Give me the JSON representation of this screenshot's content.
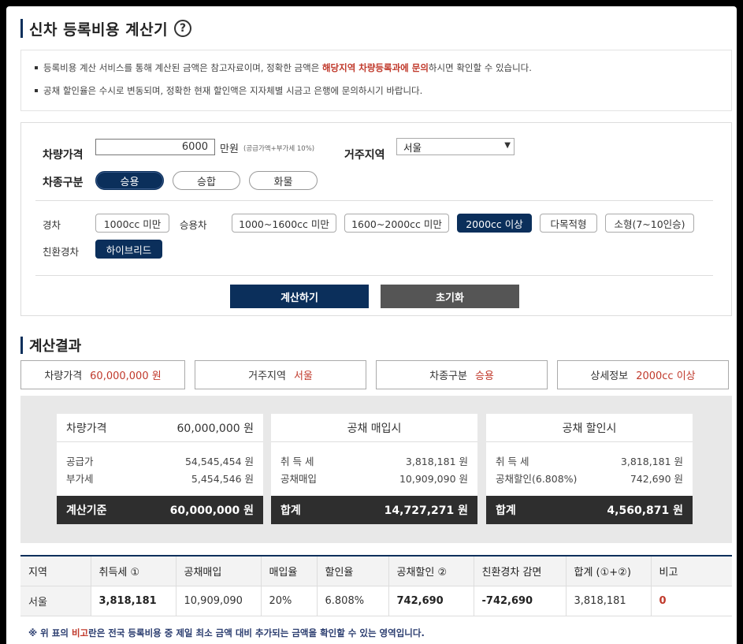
{
  "header": {
    "title": "신차 등록비용 계산기",
    "help_icon": "?"
  },
  "notice": {
    "line1_pre": "등록비용 계산 서비스를 통해 계산된 금액은 참고자료이며, 정확한 금액은 ",
    "line1_em": "해당지역 차량등록과에 문의",
    "line1_post": "하시면 확인할 수 있습니다.",
    "line2": "공채 할인율은 수시로 변동되며, 정확한 현재 할인액은 지자체별 시금고 은행에 문의하시기 바랍니다."
  },
  "form": {
    "price_label": "차량가격",
    "price_value": "6000",
    "price_unit": "만원",
    "price_note": "(공급가액+부가세 10%)",
    "region_label": "거주지역",
    "region_value": "서울",
    "type_label": "차종구분",
    "types": [
      "승용",
      "승합",
      "화물"
    ],
    "type_selected": "승용",
    "light_label": "경차",
    "light_options": [
      "1000cc 미만"
    ],
    "passenger_label": "승용차",
    "passenger_options": [
      "1000~1600cc 미만",
      "1600~2000cc 미만",
      "2000cc 이상",
      "다목적형",
      "소형(7~10인승)"
    ],
    "passenger_selected": "2000cc 이상",
    "eco_label": "친환경차",
    "eco_options": [
      "하이브리드"
    ],
    "calc_button": "계산하기",
    "reset_button": "초기화"
  },
  "result": {
    "title": "계산결과",
    "summary": [
      {
        "label": "차량가격",
        "value": "60,000,000 원"
      },
      {
        "label": "거주지역",
        "value": "서울"
      },
      {
        "label": "차종구분",
        "value": "승용"
      },
      {
        "label": "상세정보",
        "value": "2000cc 이상"
      }
    ],
    "card_price": {
      "head_label": "차량가격",
      "head_value": "60,000,000 원",
      "row1_label": "공급가",
      "row1_value": "54,545,454 원",
      "row2_label": "부가세",
      "row2_value": "5,454,546 원",
      "foot_label": "계산기준",
      "foot_value": "60,000,000 원"
    },
    "card_bond_buy": {
      "head_label": "공채 매입시",
      "row1_label": "취 득 세",
      "row1_value": "3,818,181 원",
      "row2_label": "공채매입",
      "row2_value": "10,909,090 원",
      "foot_label": "합계",
      "foot_value": "14,727,271 원"
    },
    "card_bond_discount": {
      "head_label": "공채 할인시",
      "row1_label": "취 득 세",
      "row1_value": "3,818,181 원",
      "row2_label": "공채할인(6.808%)",
      "row2_value": "742,690 원",
      "foot_label": "합계",
      "foot_value": "4,560,871 원"
    },
    "table": {
      "headers": [
        "지역",
        "취득세 ①",
        "공채매입",
        "매입율",
        "할인율",
        "공채할인 ②",
        "친환경차 감면",
        "합계 (①+②)",
        "비고"
      ],
      "row": [
        "서울",
        "3,818,181",
        "10,909,090",
        "20%",
        "6.808%",
        "742,690",
        "-742,690",
        "3,818,181",
        "0"
      ]
    },
    "footnote_pre": "※ 위 표의 ",
    "footnote_em": "비고",
    "footnote_post": "란은 전국 등록비용 중 제일 최소 금액 대비 추가되는 금액을 확인할 수 있는 영역입니다."
  }
}
